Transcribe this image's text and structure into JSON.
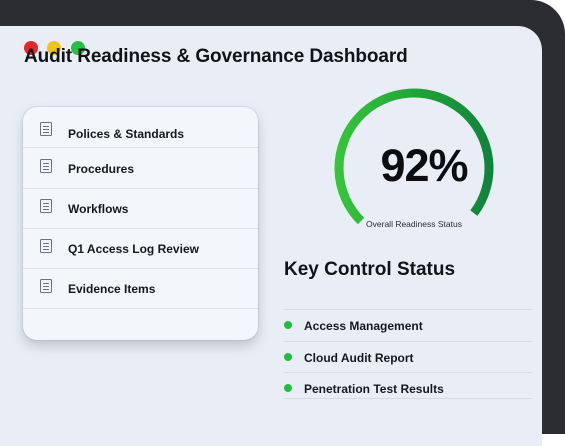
{
  "window": {
    "title": "Audit Readiness & Governance Dashboard",
    "controls": [
      "close",
      "minimize",
      "maximize"
    ]
  },
  "documents": [
    {
      "label": "Polices & Standards",
      "icon": "document-icon"
    },
    {
      "label": "Procedures",
      "icon": "document-icon"
    },
    {
      "label": "Workflows",
      "icon": "document-icon"
    },
    {
      "label": "Q1 Access Log Review",
      "icon": "document-icon"
    },
    {
      "label": "Evidence Items",
      "icon": "document-icon"
    }
  ],
  "readiness": {
    "value_text": "92%",
    "percent": 92,
    "caption": "Overall Readiness Status"
  },
  "key_control": {
    "title": "Key Control Status",
    "items": [
      {
        "label": "Access Management",
        "status_color": "#1fbf3d"
      },
      {
        "label": "Cloud Audit Report",
        "status_color": "#1fbf3d"
      },
      {
        "label": "Penetration Test Results",
        "status_color": "#1fbf3d"
      }
    ]
  },
  "colors": {
    "gauge_start": "#35c43a",
    "gauge_end": "#10843a",
    "gauge_track": "#1a9b3c"
  }
}
